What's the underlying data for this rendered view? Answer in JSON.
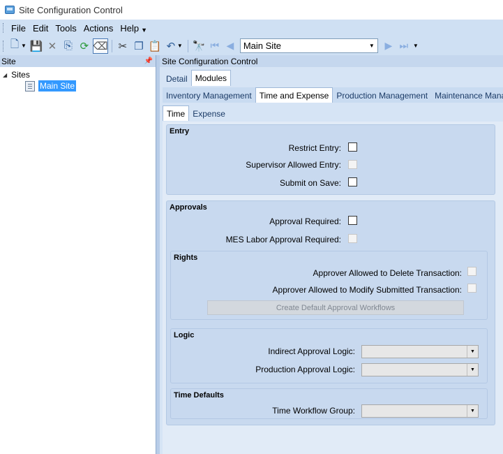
{
  "window": {
    "title": "Site Configuration Control"
  },
  "menu": {
    "items": [
      "File",
      "Edit",
      "Tools",
      "Actions",
      "Help"
    ]
  },
  "toolbar": {
    "site_combo_value": "Main Site",
    "icons": [
      "new-icon",
      "save-icon",
      "delete-icon",
      "copy-record-icon",
      "refresh-icon",
      "eraser-icon",
      "cut-icon",
      "copy-icon",
      "paste-icon",
      "undo-icon",
      "find-icon",
      "first-icon",
      "previous-icon",
      "next-icon",
      "last-icon"
    ]
  },
  "left_panel": {
    "header": "Site",
    "tree": {
      "root": "Sites",
      "child": "Main Site"
    }
  },
  "right_panel": {
    "header": "Site Configuration Control",
    "tabs_level1": [
      "Detail",
      "Modules"
    ],
    "tabs_level2": [
      "Inventory Management",
      "Time and Expense",
      "Production Management",
      "Maintenance Manage"
    ],
    "tabs_level3": [
      "Time",
      "Expense"
    ]
  },
  "entry": {
    "title": "Entry",
    "restrict_entry": "Restrict Entry:",
    "supervisor_allowed_entry": "Supervisor Allowed Entry:",
    "submit_on_save": "Submit on Save:"
  },
  "approvals": {
    "title": "Approvals",
    "approval_required": "Approval Required:",
    "mes_labor_approval_required": "MES Labor Approval Required:",
    "rights": {
      "title": "Rights",
      "allowed_delete": "Approver Allowed to Delete Transaction:",
      "allowed_modify": "Approver Allowed to Modify Submitted Transaction:",
      "create_button": "Create Default Approval Workflows"
    },
    "logic": {
      "title": "Logic",
      "indirect": "Indirect Approval Logic:",
      "production": "Production Approval Logic:"
    },
    "time_defaults": {
      "title": "Time Defaults",
      "workflow_group": "Time Workflow Group:"
    }
  }
}
